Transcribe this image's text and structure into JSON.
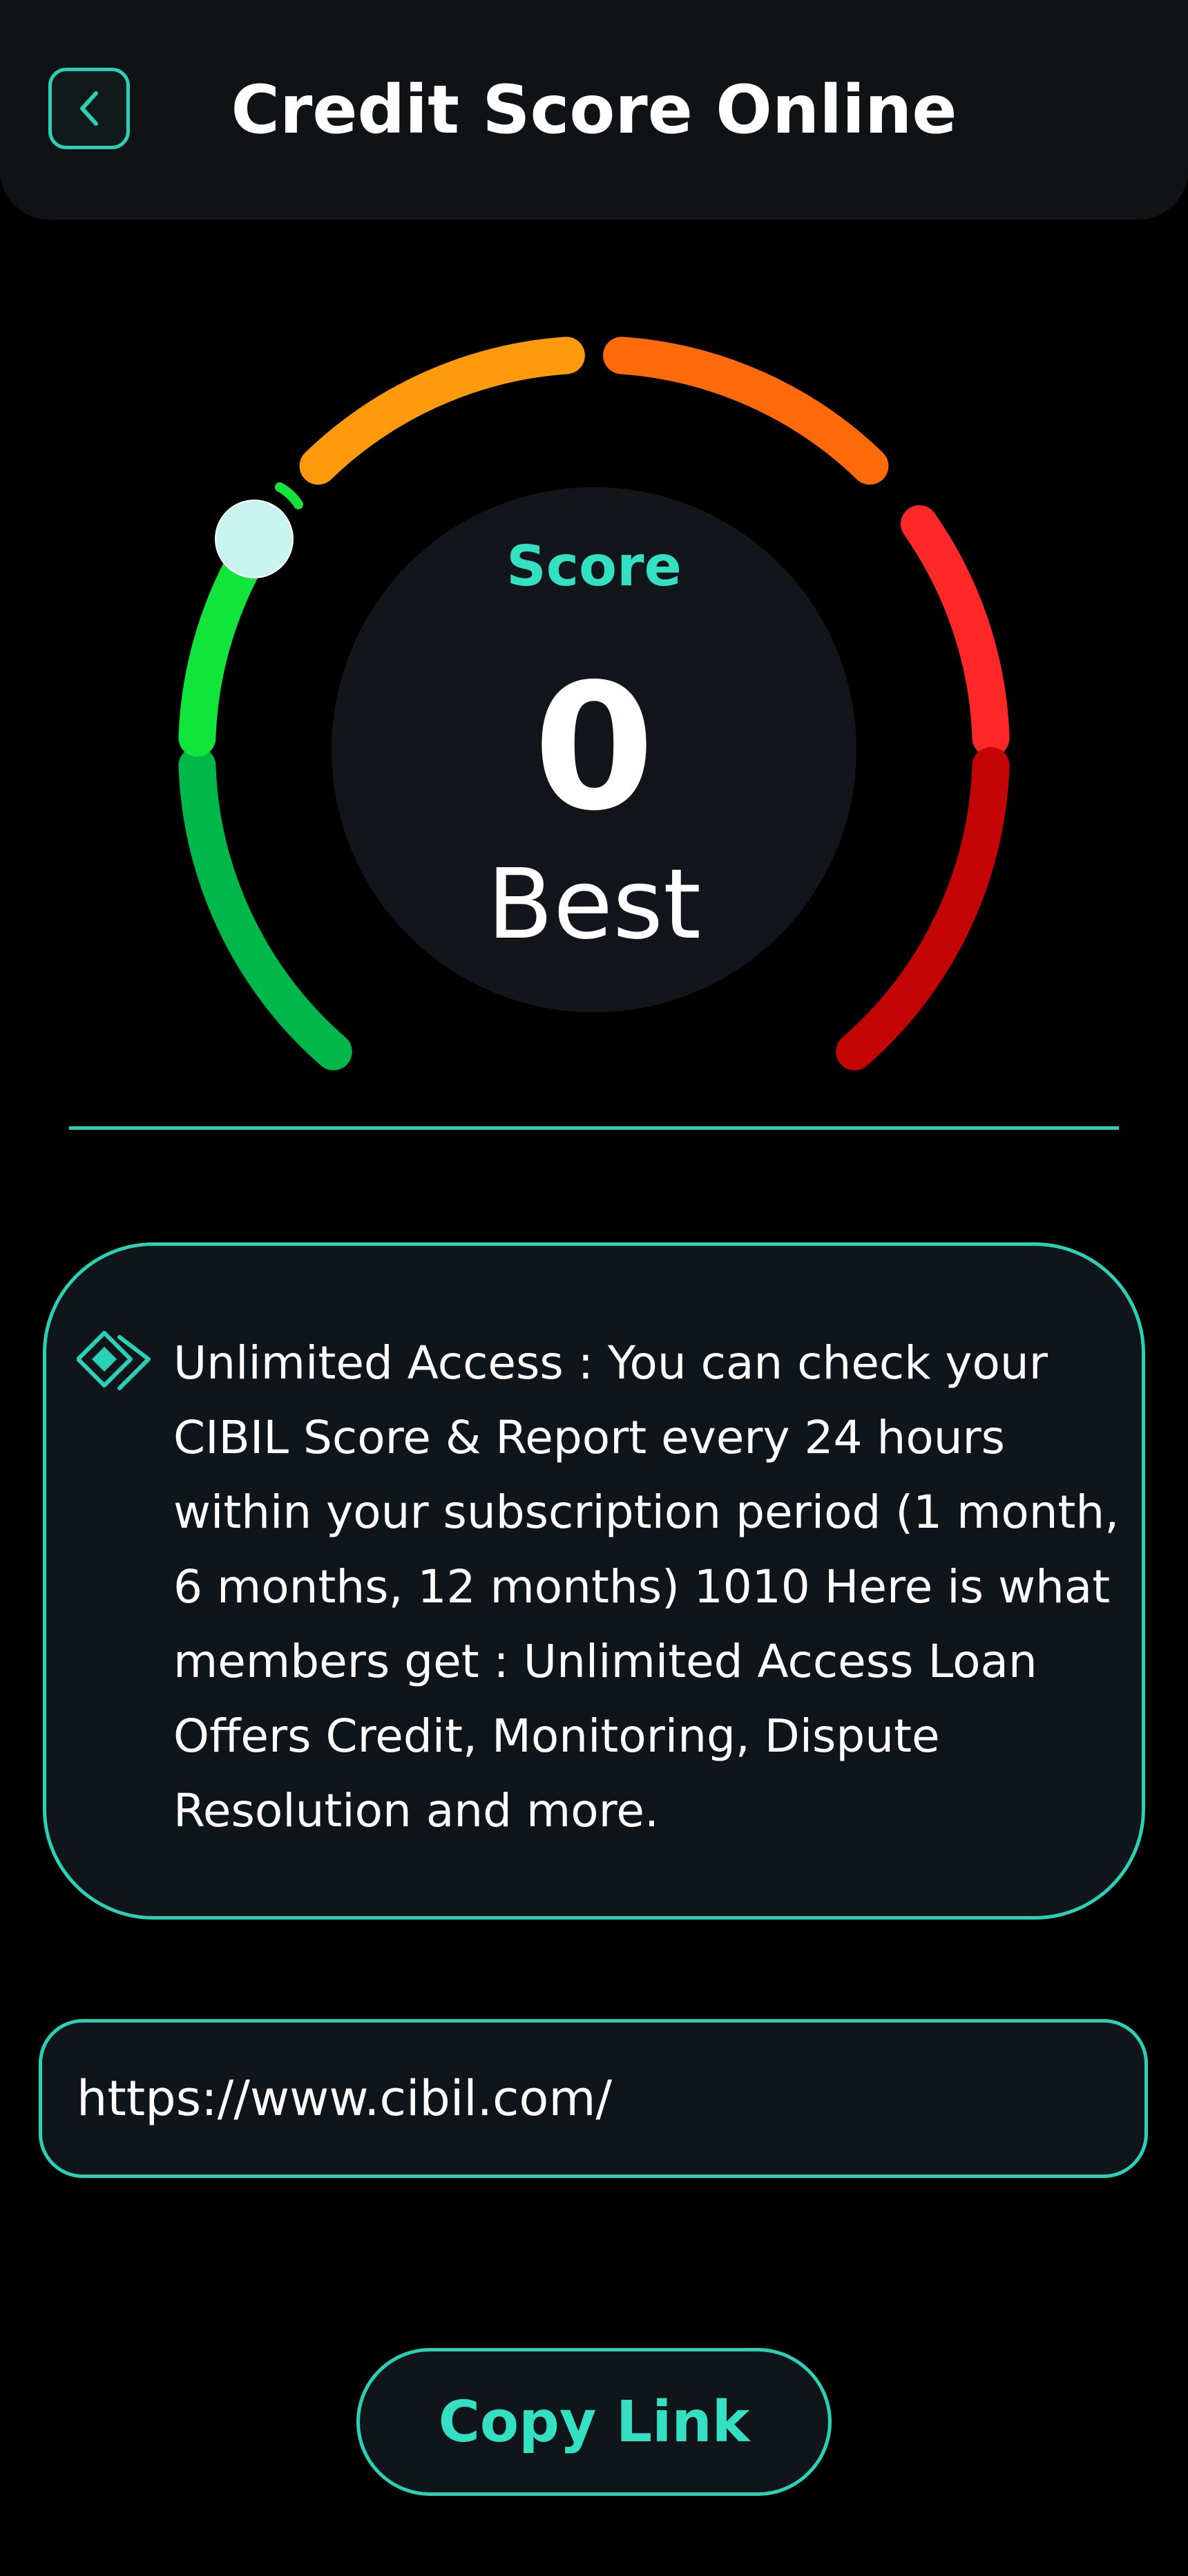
{
  "header": {
    "title": "Credit Score Online",
    "back_icon": "chevron-left-icon"
  },
  "gauge": {
    "label": "Score",
    "value": "0",
    "status": "Best",
    "pointer_fraction": 0.0,
    "segment_colors": [
      "#00b84a",
      "#11e53c",
      "#ff9a0c",
      "#ff6b0a",
      "#ff2828",
      "#c40505"
    ]
  },
  "info": {
    "icon": "diamond-icon",
    "text": "Unlimited Access : You can check your CIBIL Score & Report every 24 hours within your subscription period (1 month, 6 months, 12 months) 1010 Here is what members get : Unlimited Access Loan Offers Credit, Monitoring, Dispute Resolution and more."
  },
  "link": {
    "url": "https://www.cibil.com/"
  },
  "actions": {
    "copy_label": "Copy Link"
  },
  "colors": {
    "accent": "#2bd1b4",
    "accent_text": "#34e0c2",
    "background": "#000000",
    "surface": "#10151a"
  }
}
